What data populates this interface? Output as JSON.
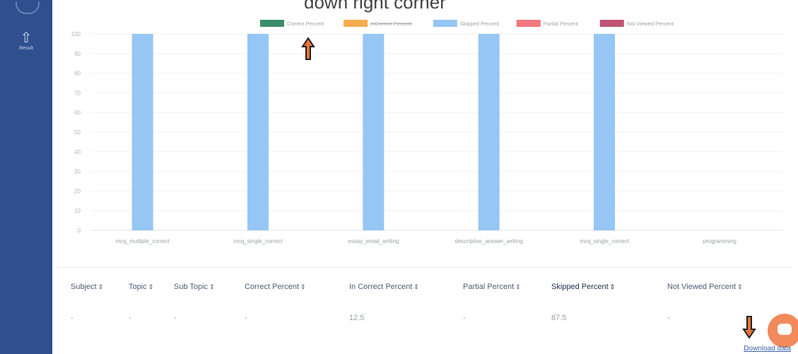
{
  "page": {
    "heading": "down right corner"
  },
  "sidebar": {
    "menu_item_label": "Result"
  },
  "chart_data": {
    "type": "bar",
    "categories": [
      "mcq_multiple_correct",
      "mcq_single_correct",
      "essay_email_writing",
      "descriptive_answer_writing",
      "mcq_single_correct",
      "programming"
    ],
    "series": [
      {
        "name": "Correct Percent",
        "color": "#3a8f6b",
        "values": [
          0,
          0,
          0,
          0,
          0,
          0
        ]
      },
      {
        "name": "InCorrect Percent",
        "color": "#f5ad4f",
        "values": [
          0,
          0,
          0,
          0,
          0,
          0
        ]
      },
      {
        "name": "Skipped Percent",
        "color": "#96c6f3",
        "values": [
          100,
          100,
          100,
          100,
          100,
          0
        ]
      },
      {
        "name": "Partial Percent",
        "color": "#f2777f",
        "values": [
          0,
          0,
          0,
          0,
          0,
          0
        ]
      },
      {
        "name": "Not Viewed Percent",
        "color": "#c05472",
        "values": [
          0,
          0,
          0,
          0,
          0,
          0
        ]
      }
    ],
    "yticks": [
      0,
      10,
      20,
      30,
      40,
      50,
      60,
      70,
      80,
      90,
      100
    ],
    "ylim": [
      0,
      100
    ],
    "grid": true,
    "legend_position": "top-center",
    "stacked": true
  },
  "table": {
    "columns": [
      "Subject",
      "Topic",
      "Sub Topic",
      "Correct Percent",
      "In Correct Percent",
      "Partial Percent",
      "Skipped Percent",
      "Not Viewed Percent"
    ],
    "sort_glyph": "⇕",
    "rows": [
      [
        "-",
        "-",
        "-",
        "-",
        "12.5",
        "-",
        "87.5",
        "-"
      ]
    ]
  },
  "footer": {
    "download_label": "Download data"
  },
  "colors": {
    "sidebar": "#2f4f8f",
    "annotation_arrow": "#e8733a",
    "chat_fab": "#f28a5c"
  }
}
